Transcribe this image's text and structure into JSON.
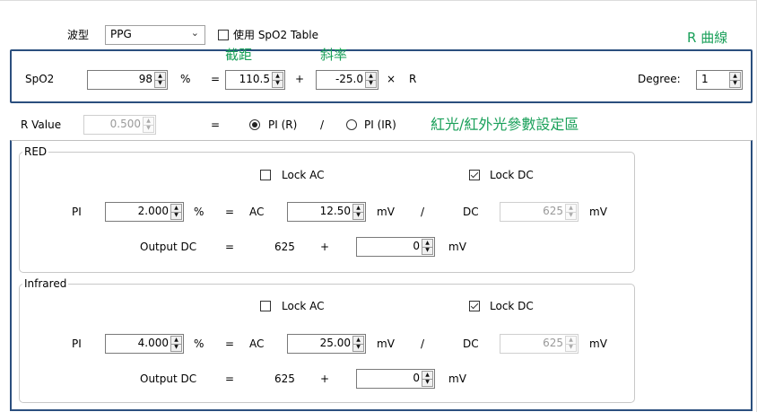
{
  "top": {
    "waveform_label": "波型",
    "waveform_value": "PPG",
    "spo2_table_label": "使用 SpO2 Table",
    "r_curve_label": "R 曲線"
  },
  "annotations": {
    "intercept": "截距",
    "slope": "斜率",
    "region": "紅光/紅外光參數設定區"
  },
  "formula": {
    "spo2_label": "SpO2",
    "spo2_value": "98",
    "percent": "%",
    "equals": "=",
    "intercept_value": "110.5",
    "plus": "+",
    "slope_value": "-25.0",
    "times": "×",
    "r": "R",
    "degree_label": "Degree:",
    "degree_value": "1"
  },
  "rvalue": {
    "label": "R Value",
    "value": "0.500",
    "equals": "=",
    "pi_r": "PI (R)",
    "slash": "/",
    "pi_ir": "PI (IR)"
  },
  "red": {
    "title": "RED",
    "lock_ac": "Lock AC",
    "lock_dc": "Lock DC",
    "pi_label": "PI",
    "pi_value": "2.000",
    "percent": "%",
    "equals": "=",
    "ac_label": "AC",
    "ac_value": "12.50",
    "mv": "mV",
    "slash": "/",
    "dc_label": "DC",
    "dc_value": "625",
    "output_dc_label": "Output DC",
    "output_dc_value": "625",
    "plus": "+",
    "offset_value": "0"
  },
  "infrared": {
    "title": "Infrared",
    "lock_ac": "Lock AC",
    "lock_dc": "Lock DC",
    "pi_label": "PI",
    "pi_value": "4.000",
    "percent": "%",
    "equals": "=",
    "ac_label": "AC",
    "ac_value": "25.00",
    "mv": "mV",
    "slash": "/",
    "dc_label": "DC",
    "dc_value": "625",
    "output_dc_label": "Output DC",
    "output_dc_value": "625",
    "plus": "+",
    "offset_value": "0"
  },
  "colors": {
    "highlight_frame": "#2b4f7e",
    "annotation_text": "#1aa05a",
    "group_border": "#c8c8c8"
  }
}
